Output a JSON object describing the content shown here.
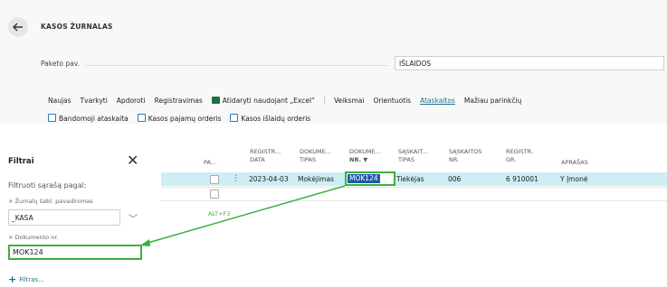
{
  "header": {
    "title": "KASOS ŽURNALAS",
    "batch_label": "Paketo pav.",
    "batch_value": "IŠLAIDOS"
  },
  "actions_row1": [
    "Naujas",
    "Tvarkyti",
    "Apdoroti",
    "Registravimas",
    "Atidaryti naudojant „Excel“",
    "Veiksmai",
    "Orientuotis",
    "Ataskaitos",
    "Mažiau parinkčių"
  ],
  "actions_row2": [
    "Bandomoji ataskaita",
    "Kasos pajamų orderis",
    "Kasos išlaidų orderis"
  ],
  "filter_pane": {
    "title": "Filtrai",
    "filter_by": "Filtruoti sąrašą pagal:",
    "criterion1_label": "Žurnalų šabl. pavadinimas",
    "criterion1_value": "_KASA",
    "criterion2_label": "Dokumento nr.",
    "criterion2_value": "MOK124",
    "add_filter": "Filtras..."
  },
  "grid": {
    "columns": [
      {
        "line1": "PA...",
        "line2": ""
      },
      {
        "line1": "REGISTR...",
        "line2": "DATA"
      },
      {
        "line1": "DOKUME...",
        "line2": "TIPAS"
      },
      {
        "line1": "DOKUME...",
        "line2": "NR. ▼"
      },
      {
        "line1": "SĄSKAIT...",
        "line2": "TIPAS"
      },
      {
        "line1": "SĄSKAITOS",
        "line2": "NR."
      },
      {
        "line1": "REGISTR.",
        "line2": "GR."
      },
      {
        "line1": "APRAŠAS",
        "line2": ""
      }
    ],
    "row1": {
      "date": "2023-04-03",
      "doc_type": "Mokėjimas",
      "doc_no": "MOK124",
      "account_type": "Tiekėjas",
      "account_no": "006",
      "posting_group": "6 910001",
      "description": "Y Įmonė"
    }
  },
  "shortcut_hint": "ALT+F3",
  "colors": {
    "accent_green": "#3cb043",
    "selected_row": "#cdeef5",
    "selection_blue": "#1e5aa8"
  }
}
